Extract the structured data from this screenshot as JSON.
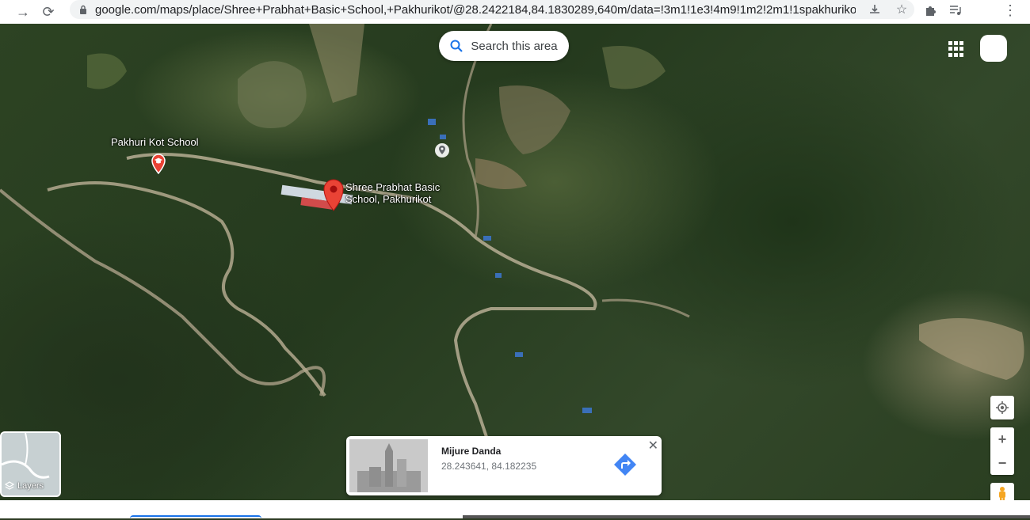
{
  "browser": {
    "url": "google.com/maps/place/Shree+Prabhat+Basic+School,+Pakhurikot/@28.2422184,84.1830289,640m/data=!3m1!1e3!4m9!1m2!2m1!1spakhurikot+k..."
  },
  "map": {
    "search_area_label": "Search this area",
    "places": [
      {
        "name": "Pakhuri Kot School"
      },
      {
        "name_line1": "Shree Prabhat Basic",
        "name_line2": "School, Pakhurikot"
      }
    ],
    "layers_label": "Layers"
  },
  "info_card": {
    "title": "Mijure Danda",
    "coords": "28.243641, 84.182235"
  },
  "colors": {
    "pin_red": "#ea4335",
    "directions_blue": "#4285f4",
    "accent_blue": "#1a73e8"
  }
}
